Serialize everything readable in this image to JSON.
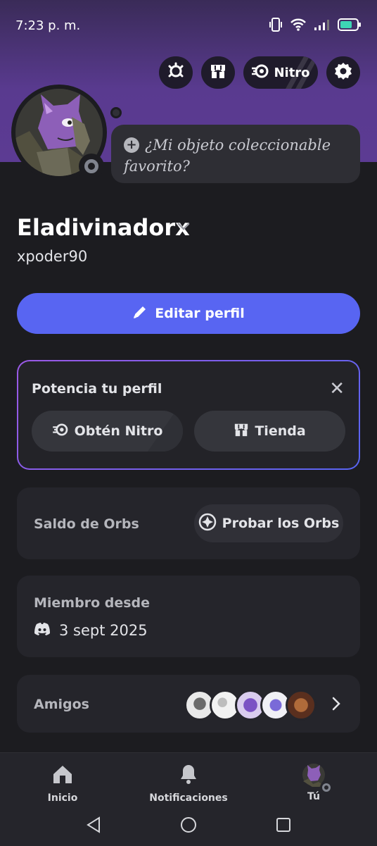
{
  "status_bar": {
    "time": "7:23 p. m."
  },
  "top_buttons": {
    "nitro_label": "Nitro"
  },
  "collectible": {
    "placeholder": "¿Mi objeto coleccionable favorito?"
  },
  "profile": {
    "display_name": "Eladivinadorx",
    "username": "xpoder90"
  },
  "edit_profile": {
    "label": "Editar perfil"
  },
  "boost": {
    "title": "Potencia tu perfil",
    "nitro_label": "Obtén Nitro",
    "shop_label": "Tienda"
  },
  "orbs": {
    "label": "Saldo de Orbs",
    "button_label": "Probar los Orbs"
  },
  "member_since": {
    "label": "Miembro desde",
    "date": "3 sept 2025"
  },
  "friends": {
    "label": "Amigos",
    "count_avatars": 5
  },
  "bottom_nav": {
    "home": "Inicio",
    "notifications": "Notificaciones",
    "you": "Tú"
  },
  "colors": {
    "accent": "#5865f2",
    "banner": "#593a8f",
    "background": "#1c1c20"
  }
}
